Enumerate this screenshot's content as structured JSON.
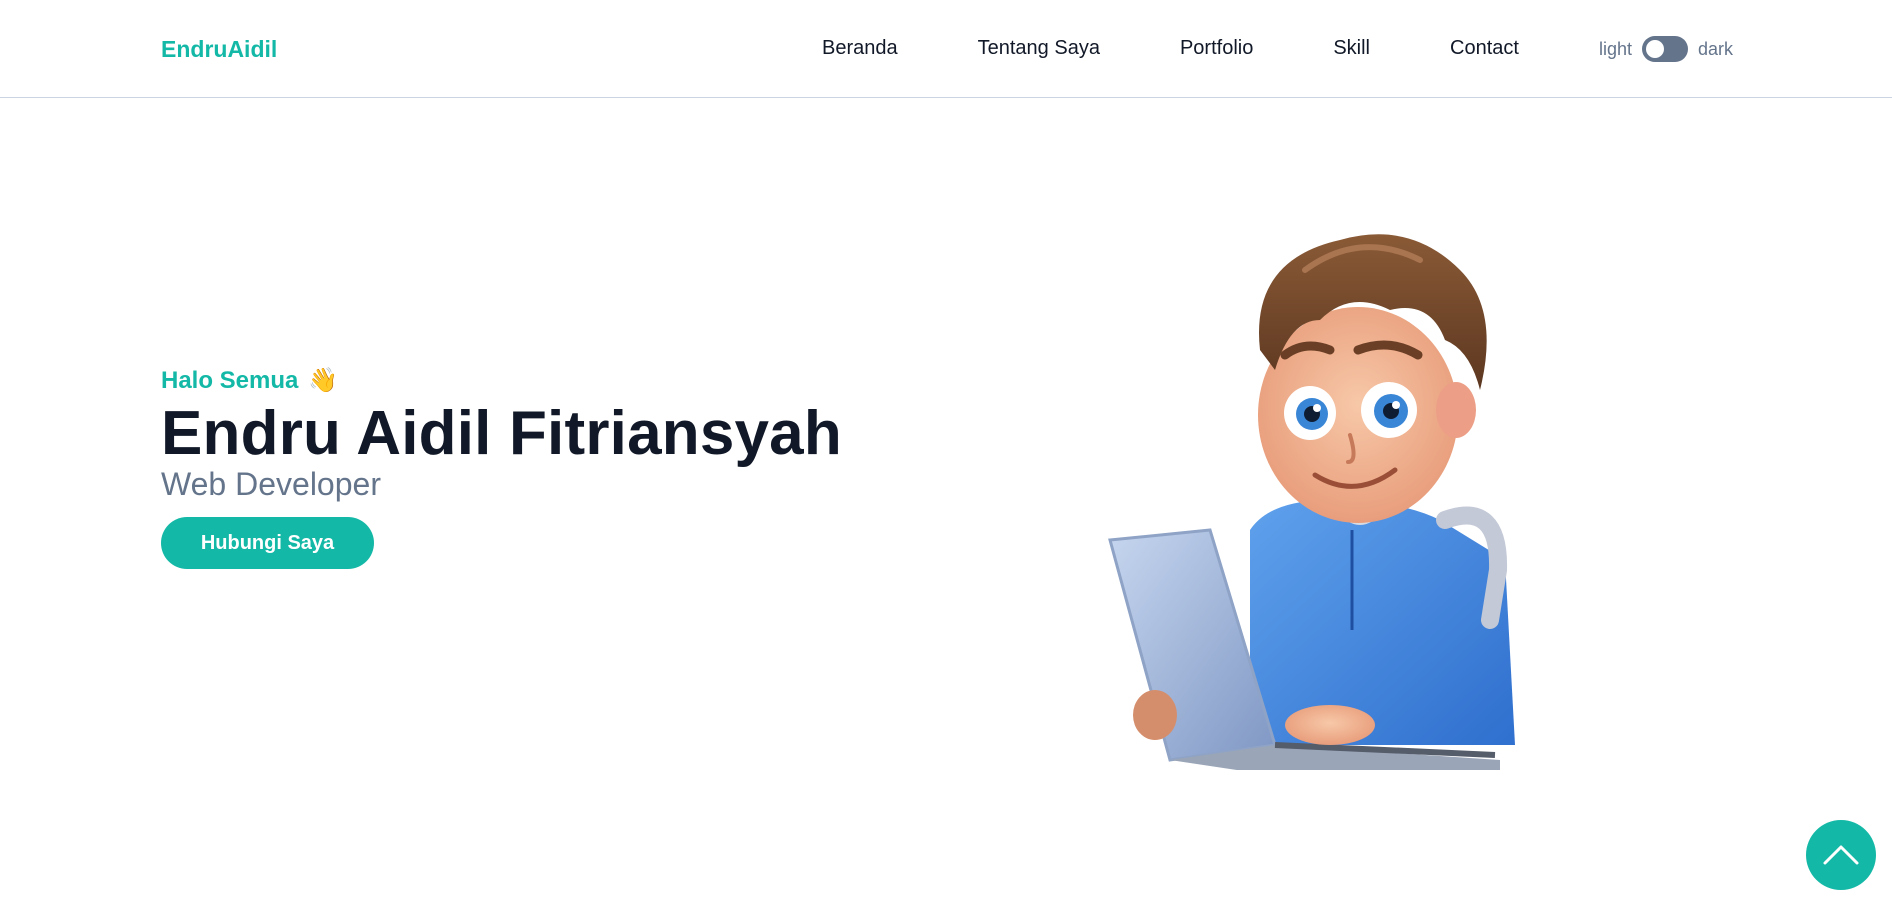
{
  "brand": {
    "logo": "EndruAidil",
    "accent": "#14b8a6"
  },
  "nav": {
    "items": [
      {
        "label": "Beranda"
      },
      {
        "label": "Tentang Saya"
      },
      {
        "label": "Portfolio"
      },
      {
        "label": "Skill"
      },
      {
        "label": "Contact"
      }
    ]
  },
  "theme_toggle": {
    "light_label": "light",
    "dark_label": "dark",
    "state": "light"
  },
  "hero": {
    "greeting": "Halo Semua",
    "greeting_emoji": "👋",
    "name": "Endru Aidil Fitriansyah",
    "role": "Web Developer",
    "cta_label": "Hubungi Saya"
  },
  "illustration": {
    "icon": "boy-with-laptop-avatar"
  },
  "back_to_top": {
    "icon": "chevron-up-icon"
  }
}
